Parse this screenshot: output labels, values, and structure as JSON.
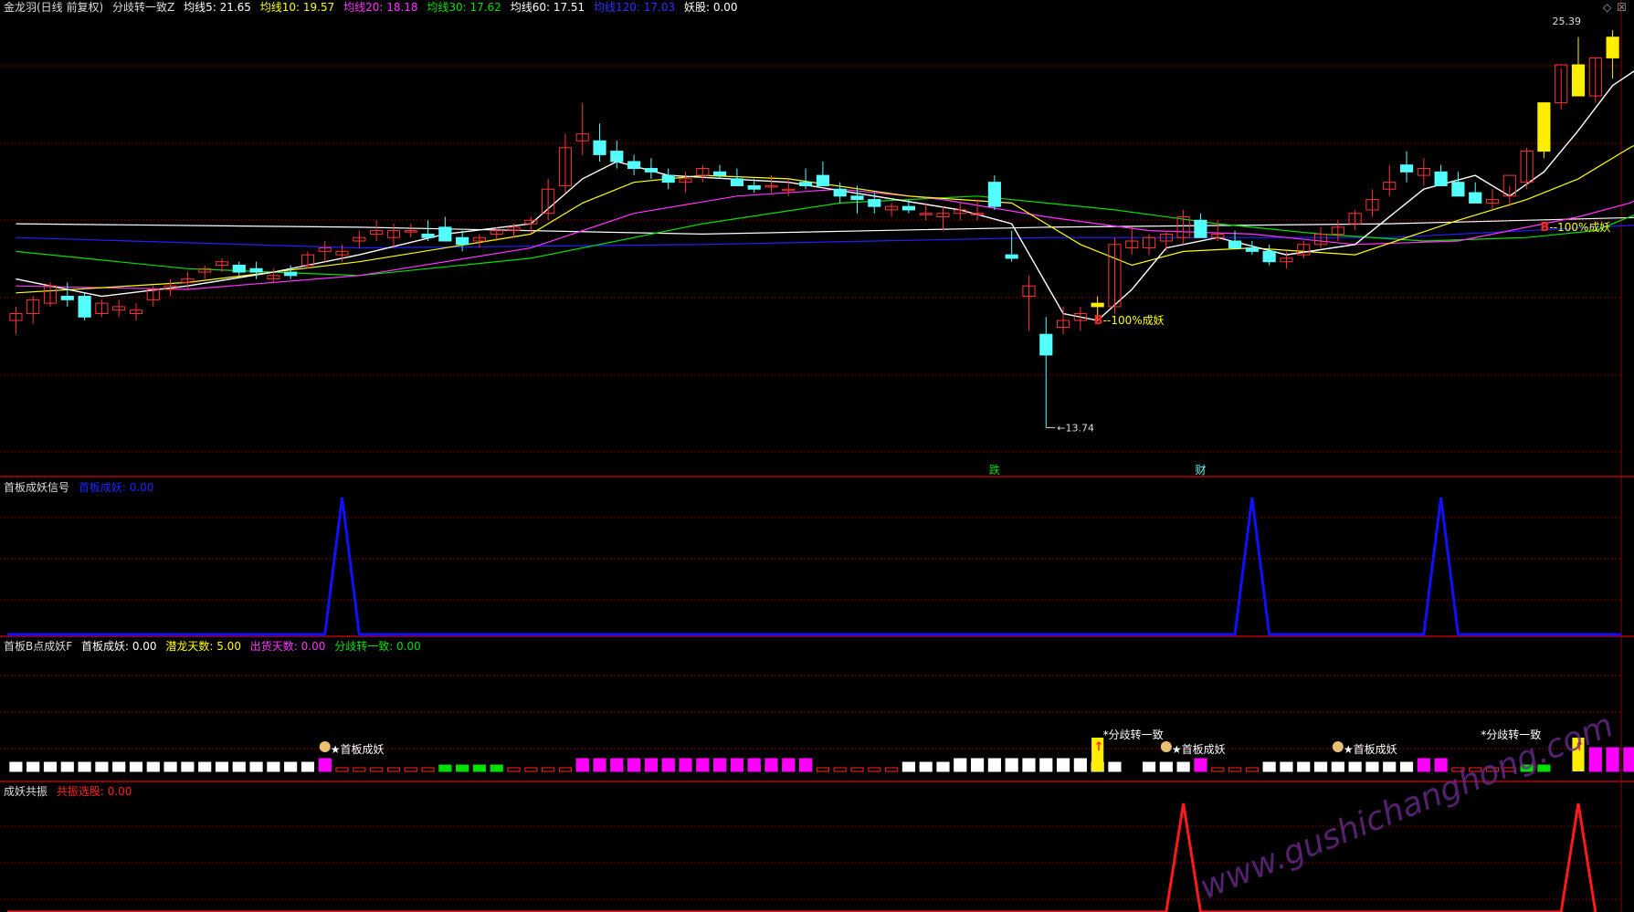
{
  "colors": {
    "bg": "#000000",
    "grid": "#7a0000",
    "up": "#ff3333",
    "down": "#54ffff",
    "ma5": "#ffffff",
    "ma10": "#ffff00",
    "ma20": "#ff33ff",
    "ma30": "#00e000",
    "ma60": "#ffffff",
    "ma120": "#2020ff",
    "signal": "#1010ff",
    "resonance": "#ff1a1a"
  },
  "main_panel": {
    "header": {
      "title": "金龙羽(日线 前复权)",
      "indicator": "分歧转一致Z",
      "ma5": "均线5: 21.65",
      "ma10": "均线10: 19.57",
      "ma20": "均线20: 18.18",
      "ma30": "均线30: 17.62",
      "ma60": "均线60: 17.51",
      "ma120": "均线120: 17.03",
      "demon": "妖股: 0.00"
    },
    "price_high_label": "25.39",
    "price_low_label": "13.74",
    "annotations": [
      {
        "text": "100%成妖",
        "marker": "B"
      },
      {
        "text": "100%成妖",
        "marker": "B"
      }
    ],
    "bottom_marks": [
      "跌",
      "财"
    ]
  },
  "panel2": {
    "header": {
      "title": "首板成妖信号",
      "value": "首板成妖: 0.00"
    }
  },
  "panel3": {
    "header": {
      "title": "首板B点成妖F",
      "v1": "首板成妖: 0.00",
      "v2": "潜龙天数: 5.00",
      "v3": "出货天数: 0.00",
      "v4": "分歧转一致: 0.00"
    },
    "labels": [
      "首板成妖",
      "分歧转一致",
      "首板成妖",
      "首板成妖",
      "分歧转一致"
    ]
  },
  "panel4": {
    "header": {
      "title": "成妖共振",
      "value": "共振选股: 0.00"
    }
  },
  "watermark": "www.gushichanghong.com",
  "chart_data": {
    "type": "candlestick",
    "ylim": [
      13.0,
      26.0
    ],
    "candles": [
      [
        17.2,
        17.6,
        16.8,
        17.4
      ],
      [
        17.4,
        17.9,
        17.1,
        17.8
      ],
      [
        17.7,
        18.3,
        17.6,
        18.2
      ],
      [
        17.9,
        18.3,
        17.6,
        17.8
      ],
      [
        17.9,
        18.0,
        17.2,
        17.3
      ],
      [
        17.4,
        17.8,
        17.3,
        17.7
      ],
      [
        17.5,
        17.8,
        17.3,
        17.6
      ],
      [
        17.4,
        17.7,
        17.2,
        17.5
      ],
      [
        17.8,
        18.2,
        17.6,
        18.1
      ],
      [
        18.1,
        18.4,
        17.9,
        18.2
      ],
      [
        18.3,
        18.6,
        18.1,
        18.4
      ],
      [
        18.6,
        18.8,
        18.4,
        18.7
      ],
      [
        18.8,
        19.0,
        18.6,
        18.9
      ],
      [
        18.8,
        18.9,
        18.5,
        18.6
      ],
      [
        18.7,
        18.9,
        18.4,
        18.6
      ],
      [
        18.4,
        18.7,
        18.3,
        18.5
      ],
      [
        18.6,
        18.8,
        18.4,
        18.5
      ],
      [
        18.8,
        19.2,
        18.7,
        19.1
      ],
      [
        19.2,
        19.5,
        18.9,
        19.3
      ],
      [
        19.1,
        19.4,
        18.9,
        19.2
      ],
      [
        19.5,
        19.8,
        19.3,
        19.6
      ],
      [
        19.7,
        20.1,
        19.5,
        19.8
      ],
      [
        19.6,
        20.0,
        19.3,
        19.8
      ],
      [
        19.8,
        20.0,
        19.6,
        19.8
      ],
      [
        19.7,
        20.1,
        19.5,
        19.6
      ],
      [
        19.9,
        20.2,
        19.5,
        19.5
      ],
      [
        19.6,
        19.8,
        19.2,
        19.4
      ],
      [
        19.5,
        19.7,
        19.3,
        19.6
      ],
      [
        19.7,
        19.9,
        19.5,
        19.8
      ],
      [
        19.8,
        20.0,
        19.6,
        19.9
      ],
      [
        20.0,
        20.2,
        19.7,
        20.1
      ],
      [
        20.3,
        21.3,
        20.1,
        21.0
      ],
      [
        21.1,
        22.6,
        20.9,
        22.2
      ],
      [
        22.4,
        23.5,
        22.0,
        22.6
      ],
      [
        22.4,
        22.9,
        21.8,
        22.0
      ],
      [
        22.1,
        22.4,
        21.6,
        21.8
      ],
      [
        21.8,
        22.0,
        21.4,
        21.6
      ],
      [
        21.6,
        21.9,
        21.3,
        21.5
      ],
      [
        21.4,
        21.6,
        21.0,
        21.2
      ],
      [
        21.2,
        21.5,
        20.9,
        21.3
      ],
      [
        21.4,
        21.7,
        21.2,
        21.6
      ],
      [
        21.5,
        21.7,
        21.3,
        21.4
      ],
      [
        21.3,
        21.6,
        21.2,
        21.1
      ],
      [
        21.1,
        21.3,
        20.9,
        21.0
      ],
      [
        21.1,
        21.4,
        20.9,
        21.1
      ],
      [
        21.0,
        21.3,
        20.8,
        21.0
      ],
      [
        21.2,
        21.6,
        21.0,
        21.1
      ],
      [
        21.4,
        21.8,
        21.2,
        21.1
      ],
      [
        21.0,
        21.2,
        20.6,
        20.8
      ],
      [
        20.8,
        21.1,
        20.3,
        20.7
      ],
      [
        20.7,
        20.9,
        20.3,
        20.5
      ],
      [
        20.4,
        20.6,
        20.2,
        20.5
      ],
      [
        20.5,
        20.7,
        20.3,
        20.4
      ],
      [
        20.3,
        20.6,
        20.1,
        20.3
      ],
      [
        20.2,
        20.5,
        19.8,
        20.3
      ],
      [
        20.3,
        20.6,
        20.1,
        20.4
      ],
      [
        20.3,
        20.7,
        20.1,
        20.3
      ],
      [
        21.2,
        21.4,
        20.4,
        20.5
      ],
      [
        19.1,
        19.8,
        18.9,
        19.0
      ],
      [
        17.9,
        18.5,
        16.9,
        18.2
      ],
      [
        16.8,
        17.3,
        14.1,
        16.2
      ],
      [
        17.0,
        17.6,
        16.8,
        17.2
      ],
      [
        17.2,
        17.6,
        16.9,
        17.4
      ],
      [
        17.6,
        17.9,
        17.2,
        17.7
      ],
      [
        17.6,
        19.6,
        17.4,
        19.4
      ],
      [
        19.3,
        19.9,
        19.1,
        19.5
      ],
      [
        19.3,
        19.7,
        19.1,
        19.6
      ],
      [
        19.5,
        19.8,
        19.2,
        19.7
      ],
      [
        19.6,
        20.4,
        19.4,
        20.2
      ],
      [
        20.1,
        20.3,
        19.9,
        19.6
      ],
      [
        19.6,
        20.1,
        19.5,
        19.7
      ],
      [
        19.5,
        19.8,
        19.3,
        19.3
      ],
      [
        19.3,
        19.5,
        19.1,
        19.2
      ],
      [
        19.2,
        19.4,
        18.8,
        18.9
      ],
      [
        18.9,
        19.2,
        18.7,
        19.0
      ],
      [
        19.1,
        19.5,
        19.0,
        19.4
      ],
      [
        19.4,
        19.9,
        19.3,
        19.7
      ],
      [
        19.7,
        20.1,
        19.5,
        19.9
      ],
      [
        20.0,
        20.4,
        19.8,
        20.3
      ],
      [
        20.4,
        21.0,
        20.2,
        20.7
      ],
      [
        21.0,
        21.7,
        20.8,
        21.2
      ],
      [
        21.7,
        22.1,
        21.2,
        21.5
      ],
      [
        21.4,
        21.9,
        21.1,
        21.6
      ],
      [
        21.5,
        21.7,
        21.1,
        21.1
      ],
      [
        21.2,
        21.5,
        20.9,
        20.8
      ],
      [
        20.9,
        21.2,
        20.6,
        20.6
      ],
      [
        20.6,
        21.0,
        20.4,
        20.7
      ],
      [
        20.8,
        21.1,
        20.5,
        21.4
      ],
      [
        21.2,
        22.2,
        21.0,
        22.1
      ],
      [
        22.1,
        22.8,
        21.9,
        23.5
      ],
      [
        23.5,
        24.5,
        23.3,
        24.6
      ],
      [
        24.6,
        25.4,
        23.8,
        23.7
      ],
      [
        23.7,
        24.8,
        23.5,
        24.8
      ],
      [
        24.8,
        25.6,
        24.2,
        25.4
      ]
    ],
    "ma": {
      "ma5": [
        [
          0,
          18.4
        ],
        [
          5,
          17.9
        ],
        [
          10,
          18.2
        ],
        [
          15,
          18.6
        ],
        [
          20,
          19.1
        ],
        [
          25,
          19.7
        ],
        [
          30,
          20.0
        ],
        [
          33,
          21.3
        ],
        [
          35,
          21.8
        ],
        [
          38,
          21.4
        ],
        [
          45,
          21.2
        ],
        [
          55,
          20.4
        ],
        [
          58,
          20.0
        ],
        [
          61,
          17.4
        ],
        [
          63,
          17.2
        ],
        [
          65,
          18.1
        ],
        [
          67,
          19.3
        ],
        [
          70,
          19.6
        ],
        [
          74,
          19.1
        ],
        [
          78,
          19.4
        ],
        [
          82,
          21.0
        ],
        [
          85,
          21.4
        ],
        [
          87,
          20.8
        ],
        [
          89,
          21.5
        ],
        [
          91,
          22.7
        ],
        [
          93,
          24.0
        ],
        [
          96,
          25.0
        ]
      ],
      "ma10": [
        [
          0,
          18.0
        ],
        [
          10,
          18.3
        ],
        [
          20,
          18.9
        ],
        [
          30,
          19.7
        ],
        [
          33,
          20.6
        ],
        [
          36,
          21.2
        ],
        [
          40,
          21.4
        ],
        [
          45,
          21.3
        ],
        [
          52,
          20.8
        ],
        [
          58,
          20.6
        ],
        [
          62,
          19.4
        ],
        [
          65,
          18.8
        ],
        [
          68,
          19.2
        ],
        [
          72,
          19.3
        ],
        [
          78,
          19.1
        ],
        [
          84,
          20.1
        ],
        [
          88,
          20.7
        ],
        [
          91,
          21.3
        ],
        [
          94,
          22.2
        ],
        [
          96,
          22.7
        ]
      ],
      "ma20": [
        [
          0,
          18.2
        ],
        [
          10,
          18.1
        ],
        [
          20,
          18.5
        ],
        [
          30,
          19.3
        ],
        [
          36,
          20.3
        ],
        [
          42,
          20.8
        ],
        [
          48,
          21.0
        ],
        [
          54,
          20.7
        ],
        [
          60,
          20.2
        ],
        [
          66,
          19.8
        ],
        [
          72,
          19.7
        ],
        [
          78,
          19.4
        ],
        [
          84,
          19.5
        ],
        [
          88,
          19.9
        ],
        [
          91,
          20.2
        ],
        [
          94,
          20.6
        ],
        [
          96,
          21.1
        ]
      ],
      "ma30": [
        [
          0,
          19.2
        ],
        [
          10,
          18.7
        ],
        [
          20,
          18.5
        ],
        [
          30,
          19.0
        ],
        [
          40,
          20.0
        ],
        [
          48,
          20.6
        ],
        [
          56,
          20.8
        ],
        [
          64,
          20.4
        ],
        [
          70,
          20.0
        ],
        [
          76,
          19.7
        ],
        [
          82,
          19.5
        ],
        [
          88,
          19.6
        ],
        [
          92,
          19.8
        ],
        [
          96,
          20.6
        ]
      ],
      "ma60": [
        [
          0,
          20.0
        ],
        [
          20,
          19.9
        ],
        [
          40,
          19.7
        ],
        [
          60,
          19.9
        ],
        [
          80,
          20.0
        ],
        [
          96,
          20.2
        ]
      ],
      "ma120": [
        [
          0,
          19.6
        ],
        [
          20,
          19.3
        ],
        [
          40,
          19.4
        ],
        [
          60,
          19.6
        ],
        [
          80,
          19.6
        ],
        [
          96,
          20.0
        ]
      ]
    },
    "signal_spikes": [
      19,
      72,
      83
    ],
    "resonance_spikes": [
      68,
      91
    ],
    "panel3_bars": {
      "white": [
        0,
        1,
        2,
        3,
        4,
        5,
        6,
        7,
        8,
        9,
        10,
        11,
        12,
        13,
        14,
        15,
        16,
        17,
        52,
        53,
        54,
        55,
        56,
        57,
        58,
        59,
        60,
        61,
        62,
        63,
        64,
        66,
        67,
        68,
        73,
        74,
        75,
        76,
        77,
        78,
        79,
        80,
        81
      ],
      "red": [
        19,
        20,
        21,
        22,
        23,
        24,
        29,
        30,
        31,
        32,
        47,
        48,
        49,
        50,
        51,
        70,
        71,
        72,
        84,
        85,
        86,
        87
      ],
      "green": [
        25,
        26,
        27,
        28,
        33,
        34,
        35,
        36,
        37,
        38,
        39,
        40,
        41,
        42,
        43,
        44,
        45,
        46,
        88,
        89
      ],
      "magenta": [
        18,
        33,
        34,
        35,
        36,
        37,
        38,
        39,
        40,
        41,
        42,
        43,
        44,
        45,
        46,
        69,
        82,
        83,
        92,
        93,
        94,
        95
      ]
    }
  }
}
